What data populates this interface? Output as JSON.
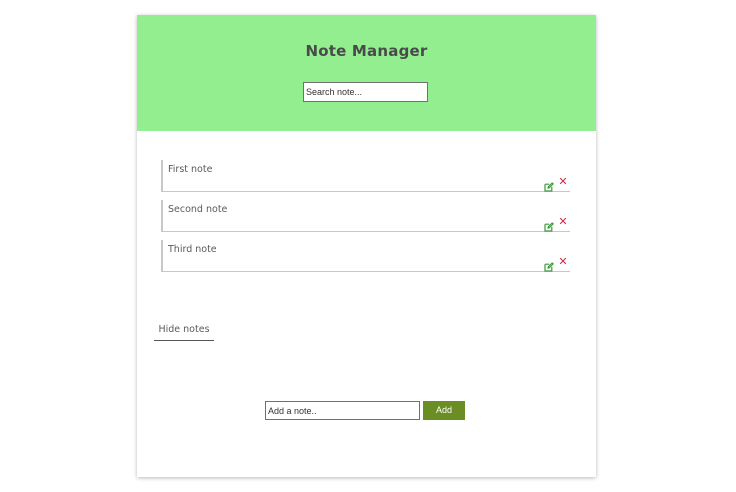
{
  "app": {
    "title": "Note Manager"
  },
  "search": {
    "placeholder": "Search note...",
    "value": ""
  },
  "notes": [
    {
      "text": "First note",
      "edit_icon": "edit-icon",
      "delete_icon": "close-icon",
      "delete_glyph": "✕"
    },
    {
      "text": "Second note",
      "edit_icon": "edit-icon",
      "delete_icon": "close-icon",
      "delete_glyph": "✕"
    },
    {
      "text": "Third note",
      "edit_icon": "edit-icon",
      "delete_icon": "close-icon",
      "delete_glyph": "✕"
    }
  ],
  "toggle": {
    "label": "Hide notes"
  },
  "add": {
    "placeholder": "Add a note..",
    "value": "",
    "button_label": "Add"
  },
  "colors": {
    "header_bg": "#93ee8f",
    "add_button_bg": "#6a8e23",
    "edit_icon": "#3a9a3a",
    "delete_icon": "#d6284a"
  }
}
